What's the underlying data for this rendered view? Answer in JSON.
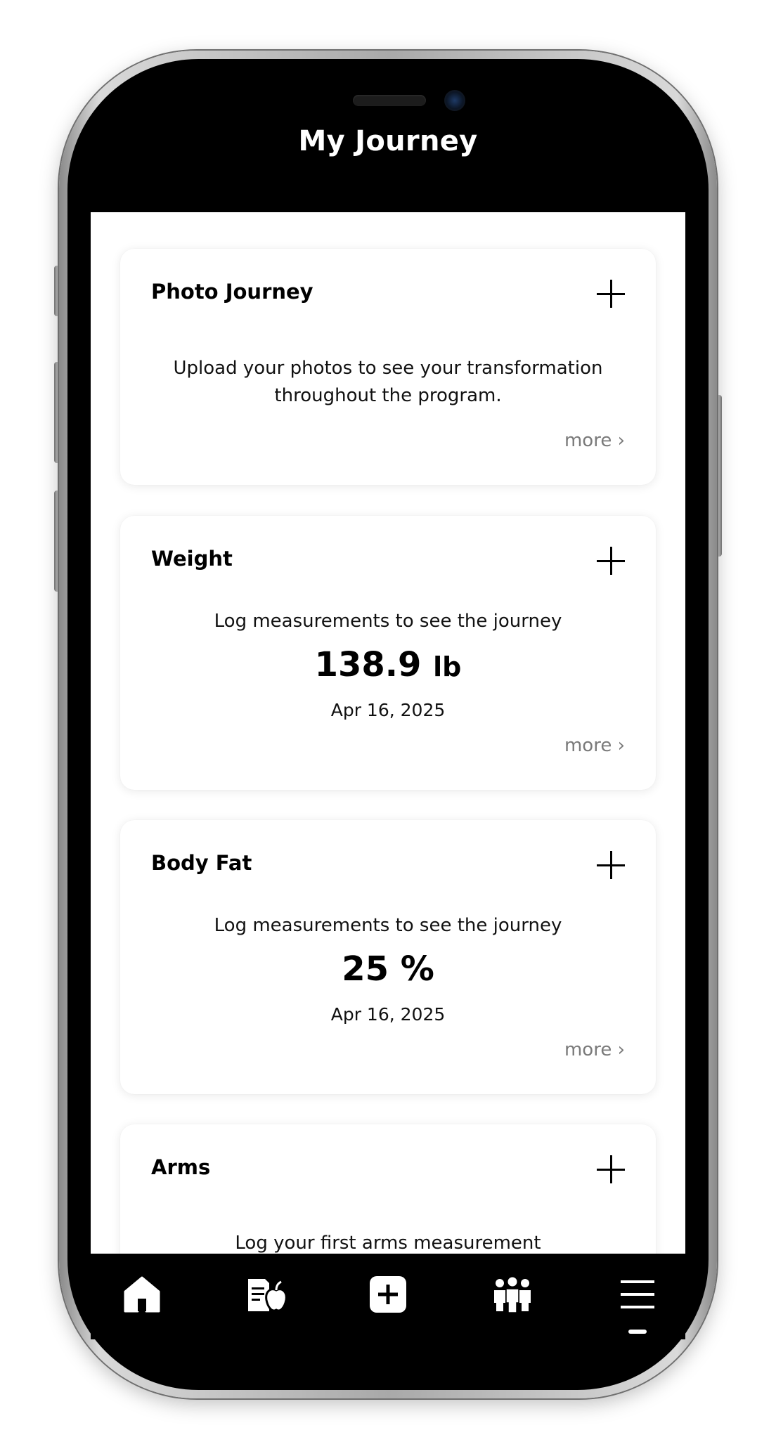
{
  "header": {
    "title": "My Journey"
  },
  "cards": [
    {
      "title": "Photo Journey",
      "description": "Upload your photos to see your transformation throughout the program.",
      "more_label": "more ›"
    },
    {
      "title": "Weight",
      "description": "Log measurements to see the journey",
      "value": "138.9",
      "unit": "lb",
      "date": "Apr 16, 2025",
      "more_label": "more ›"
    },
    {
      "title": "Body Fat",
      "description": "Log measurements to see the journey",
      "value": "25",
      "unit": "%",
      "date": "Apr 16, 2025",
      "more_label": "more ›"
    },
    {
      "title": "Arms",
      "description": "Log your first arms measurement"
    }
  ],
  "nav": {
    "items": [
      {
        "icon": "home-icon"
      },
      {
        "icon": "nutrition-icon"
      },
      {
        "icon": "add-icon"
      },
      {
        "icon": "community-icon"
      },
      {
        "icon": "menu-icon"
      }
    ]
  },
  "colors": {
    "background": "#000000",
    "card": "#ffffff",
    "muted_text": "#7a7a7a"
  }
}
